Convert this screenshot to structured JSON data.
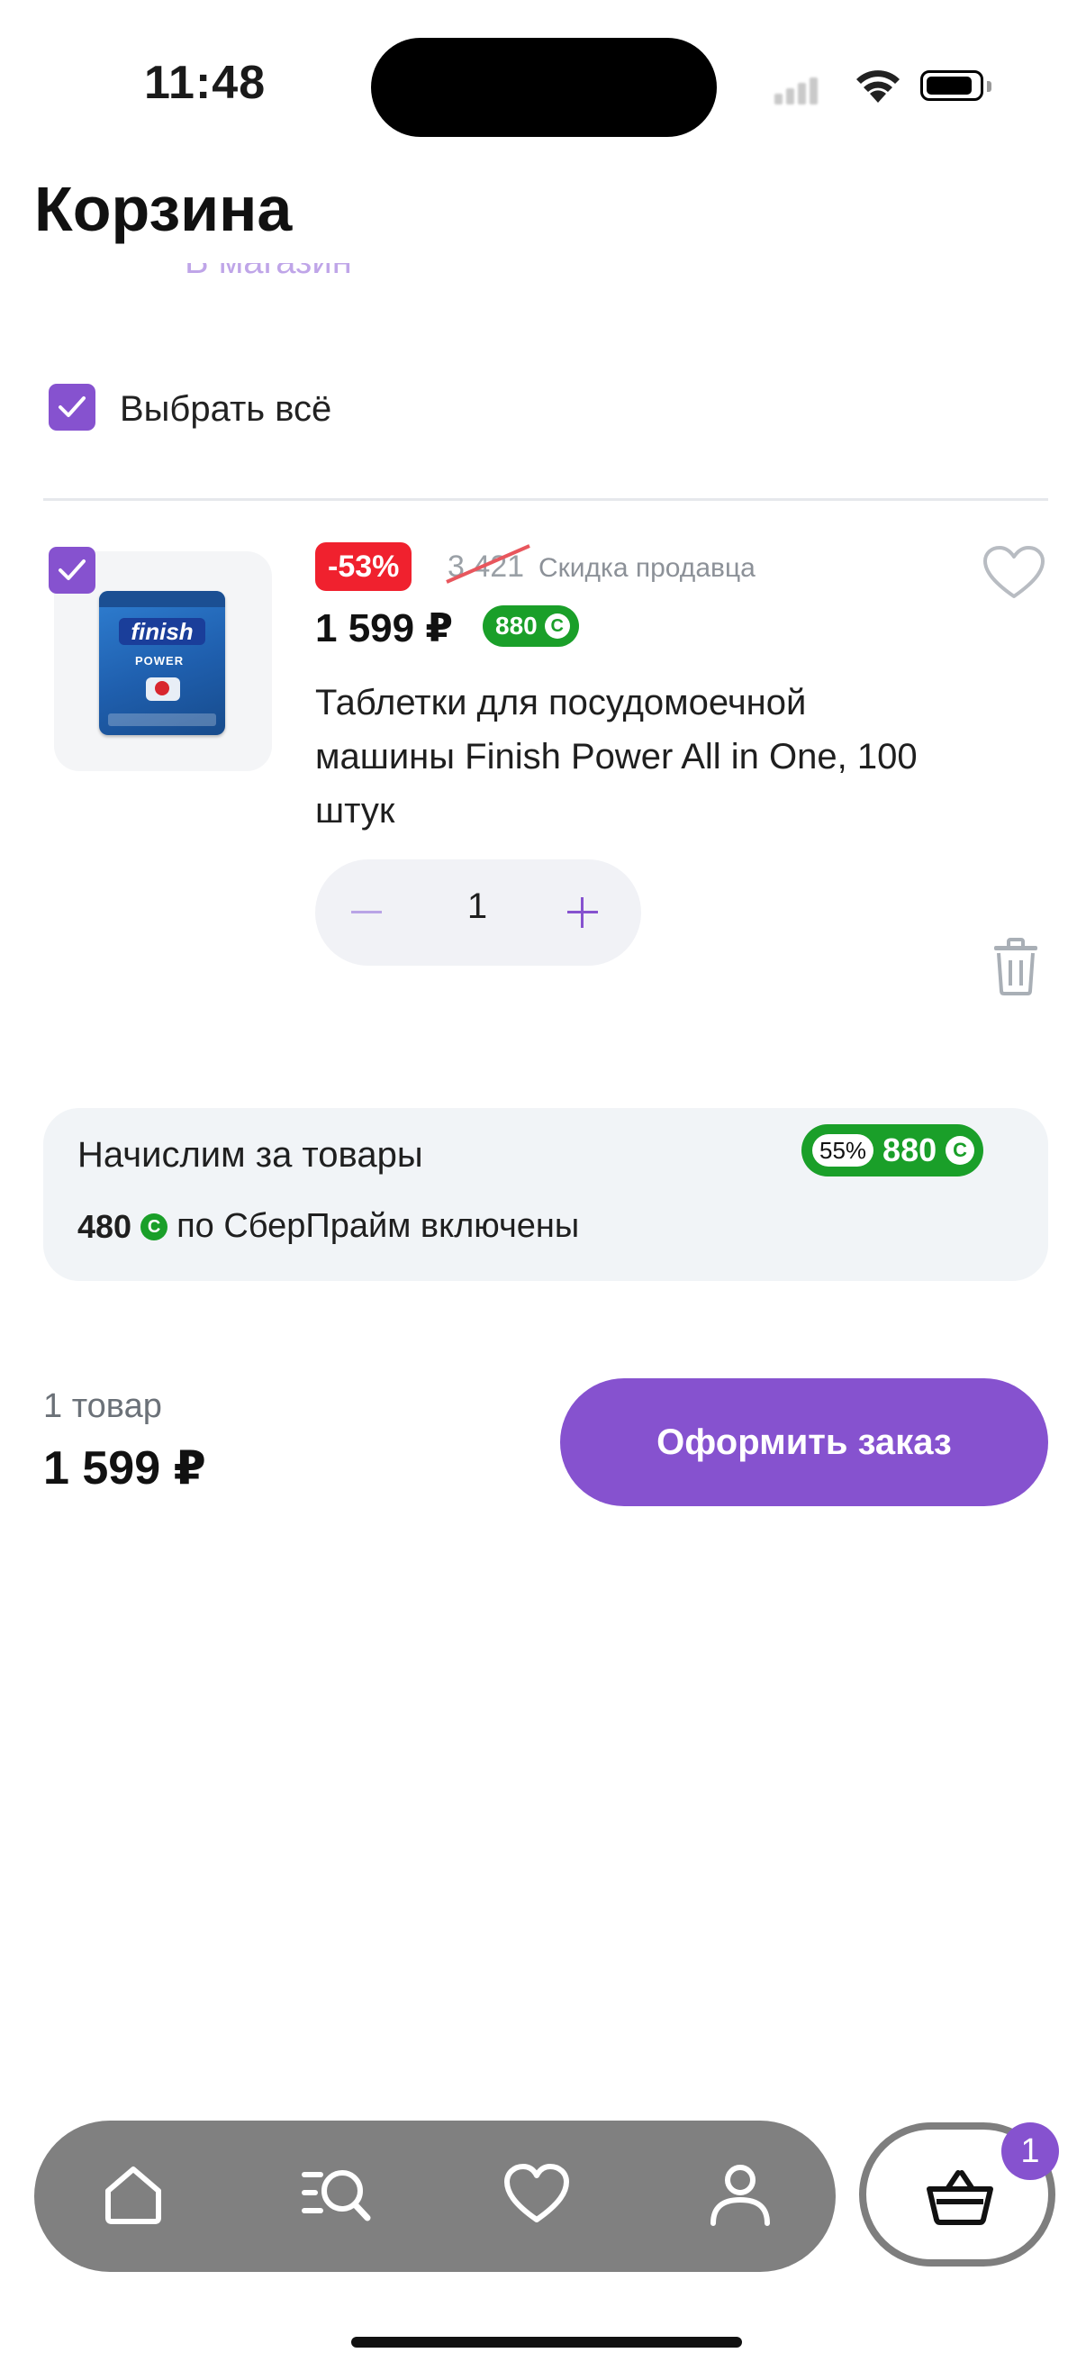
{
  "status_bar": {
    "time": "11:48"
  },
  "header": {
    "title": "Корзина",
    "scrolled_link": "В магазин"
  },
  "select_all": {
    "label": "Выбрать всё",
    "checked": true
  },
  "product": {
    "checked": true,
    "discount": "-53%",
    "old_price": "3 421",
    "discount_source": "Скидка продавца",
    "price": "1 599 ₽",
    "bonus": "880",
    "bonus_icon": "С",
    "name": "Таблетки для посудомоечной машины Finish Power All in One, 100 штук",
    "image_brand": "finish",
    "image_subtitle": "POWER",
    "quantity": "1"
  },
  "bonus_card": {
    "title": "Начислим за товары",
    "percent": "55%",
    "amount": "880",
    "prime_amount": "480",
    "prime_text": "по СберПрайм включены"
  },
  "summary": {
    "count_label": "1 товар",
    "total": "1 599 ₽",
    "checkout_label": "Оформить заказ"
  },
  "tabbar": {
    "items": [
      "home-icon",
      "catalog-search-icon",
      "heart-icon",
      "profile-icon"
    ],
    "cart_badge": "1"
  },
  "colors": {
    "accent": "#8652cf",
    "discount": "#f0212e",
    "bonus_green": "#1a9f29"
  }
}
